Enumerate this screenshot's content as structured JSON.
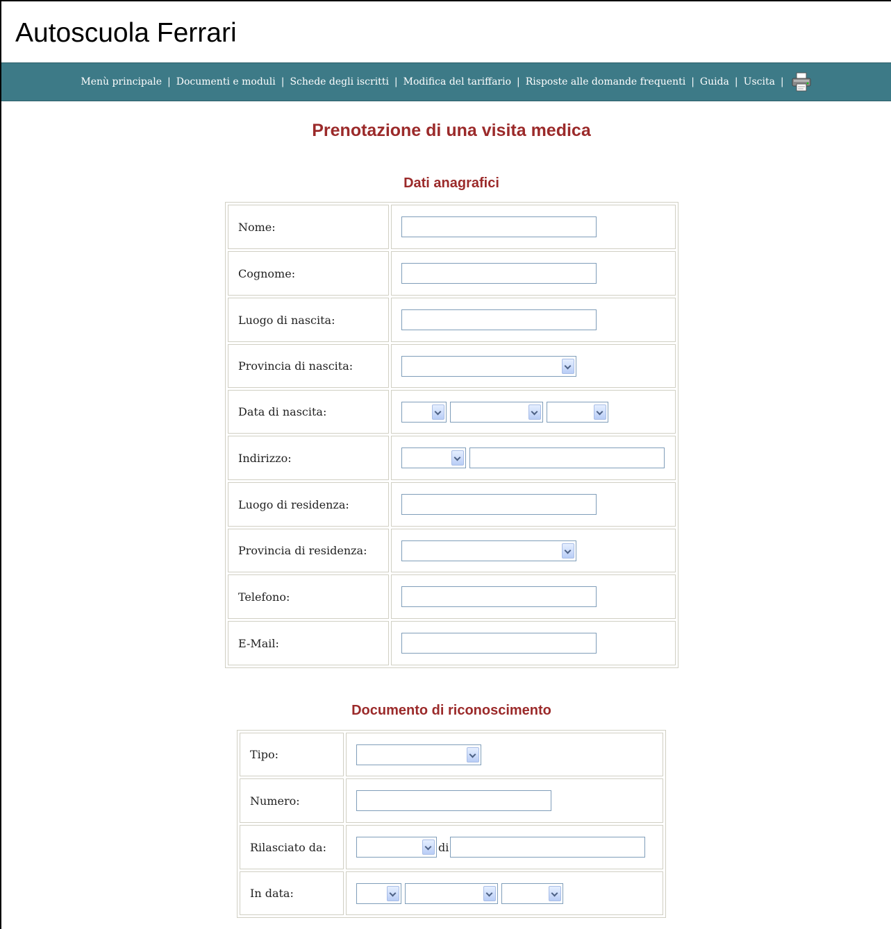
{
  "app": {
    "title": "Autoscuola Ferrari"
  },
  "nav": {
    "items": [
      "Menù principale",
      "Documenti e moduli",
      "Schede degli iscritti",
      "Modifica del tariffario",
      "Risposte alle domande frequenti",
      "Guida",
      "Uscita"
    ],
    "separator": "|",
    "print_icon": "printer-icon"
  },
  "page": {
    "title": "Prenotazione di una visita medica"
  },
  "anagrafici": {
    "title": "Dati anagrafici",
    "nome": "Nome:",
    "cognome": "Cognome:",
    "luogo_nascita": "Luogo di nascita:",
    "provincia_nascita": "Provincia di nascita:",
    "data_nascita": "Data di nascita:",
    "indirizzo": "Indirizzo:",
    "luogo_residenza": "Luogo di residenza:",
    "provincia_residenza": "Provincia di residenza:",
    "telefono": "Telefono:",
    "email": "E-Mail:"
  },
  "documento": {
    "title": "Documento di riconoscimento",
    "tipo": "Tipo:",
    "numero": "Numero:",
    "rilasciato_da": "Rilasciato da:",
    "di": "di",
    "in_data": "In data:"
  },
  "colors": {
    "nav_bg": "#3d7a87",
    "heading": "#9b2a2a",
    "input_border": "#7f9db9",
    "cell_border": "#d0cfc3"
  }
}
